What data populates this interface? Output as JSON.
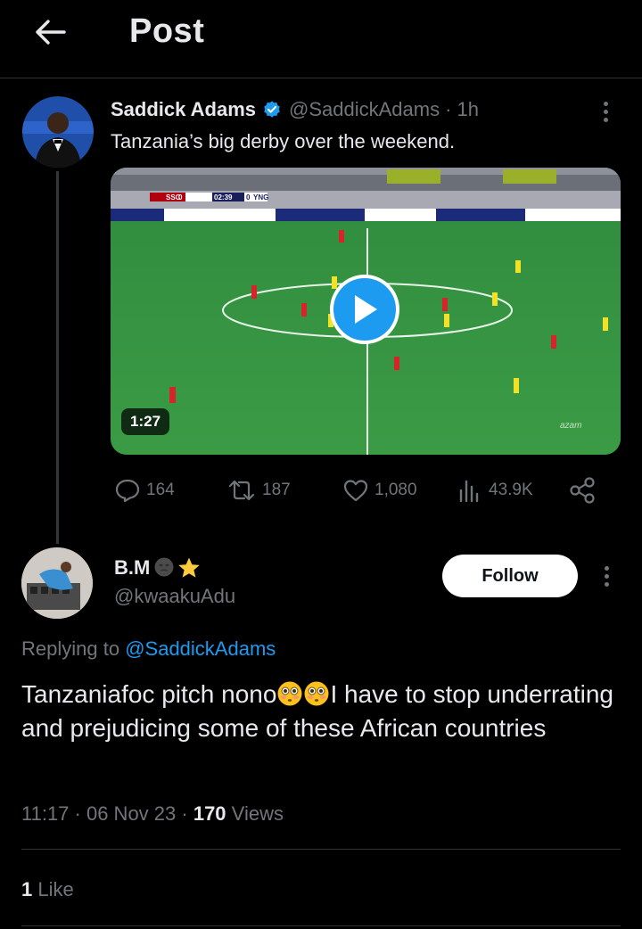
{
  "header": {
    "title": "Post",
    "back_icon": "arrow-left-icon"
  },
  "tweet": {
    "author_name": "Saddick Adams",
    "handle": "@SaddickAdams",
    "time": "· 1h",
    "verified": true,
    "text": "Tanzania’s big derby over the weekend.",
    "video": {
      "duration": "1:27",
      "score_home": "SSC",
      "score_home_goals": "0",
      "clock": "02:39",
      "score_away_goals": "0",
      "score_away": "YNG",
      "watermark": "azam"
    },
    "stats": {
      "replies": "164",
      "reposts": "187",
      "likes": "1,080",
      "views": "43.9K"
    }
  },
  "reply": {
    "author_name": "B.M",
    "handle": "@kwaakuAdu",
    "follow_label": "Follow",
    "replying_prefix": "Replying to",
    "replying_to": "@SaddickAdams",
    "text_part1": "Tanzaniafoc pitch nono",
    "text_part2": "I have to stop underrating and prejudicing some of these African countries",
    "time": "11:17 · 06 Nov 23 ·",
    "views_count": "170",
    "views_label": "Views",
    "likes_count": "1",
    "likes_label": "Like"
  },
  "colors": {
    "accent": "#1d9bf0",
    "muted": "#71767b",
    "divider": "#2f3336",
    "background": "#000000"
  }
}
